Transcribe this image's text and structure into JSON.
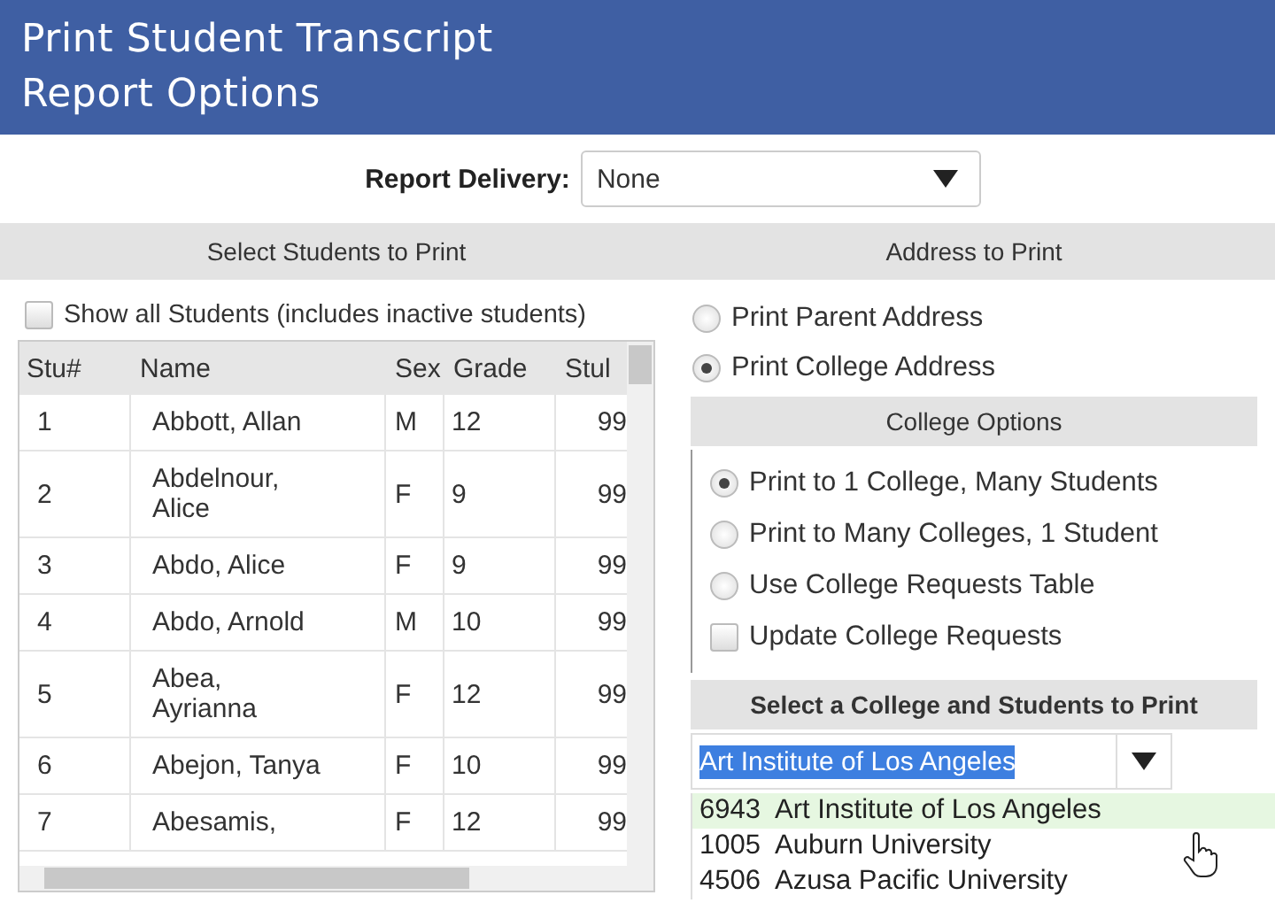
{
  "header": {
    "title_lines": [
      "Print Student Transcript",
      "Report Options"
    ]
  },
  "report_delivery": {
    "label": "Report Delivery:",
    "value": "None"
  },
  "students": {
    "heading": "Select Students to Print",
    "show_all": {
      "label": "Show all Students (includes inactive students)",
      "checked": false
    },
    "columns": [
      "Stu#",
      "Name",
      "Sex",
      "Grade",
      "Stul"
    ],
    "rows": [
      [
        "1",
        "Abbott, Allan",
        "M",
        "12",
        "99"
      ],
      [
        "2",
        "Abdelnour, Alice",
        "F",
        "9",
        "99"
      ],
      [
        "3",
        "Abdo, Alice",
        "F",
        "9",
        "99"
      ],
      [
        "4",
        "Abdo, Arnold",
        "M",
        "10",
        "99"
      ],
      [
        "5",
        "Abea, Ayrianna",
        "F",
        "12",
        "99"
      ],
      [
        "6",
        "Abejon, Tanya",
        "F",
        "10",
        "99"
      ],
      [
        "7",
        "Abesamis,",
        "F",
        "12",
        "99"
      ]
    ]
  },
  "address": {
    "heading": "Address to Print",
    "options": [
      {
        "label": "Print Parent Address",
        "selected": false
      },
      {
        "label": "Print College Address",
        "selected": true
      }
    ],
    "college_options": {
      "heading": "College Options",
      "items": [
        {
          "kind": "radio",
          "label": "Print to 1 College, Many Students",
          "selected": true
        },
        {
          "kind": "radio",
          "label": "Print to Many Colleges, 1 Student",
          "selected": false
        },
        {
          "kind": "radio",
          "label": "Use College Requests Table",
          "selected": false
        },
        {
          "kind": "checkbox",
          "label": "Update College Requests",
          "checked": false
        }
      ]
    },
    "college_select": {
      "heading": "Select a College and Students to Print",
      "value": "Art Institute of Los Angeles",
      "list": [
        {
          "code": "6943",
          "name": "Art Institute of Los Angeles",
          "hovered": true
        },
        {
          "code": "1005",
          "name": "Auburn University",
          "hovered": false
        },
        {
          "code": "4506",
          "name": "Azusa Pacific University",
          "hovered": false
        }
      ]
    }
  }
}
